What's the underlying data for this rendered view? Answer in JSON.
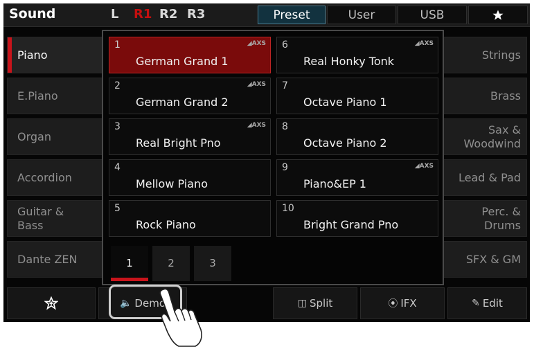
{
  "header": {
    "title": "Sound",
    "parts": [
      "L",
      "R1",
      "R2",
      "R3"
    ],
    "active_part": "R1",
    "tabs": [
      "Preset",
      "User",
      "USB"
    ],
    "active_tab": "Preset",
    "favorite_icon": "star-icon"
  },
  "categories_left": [
    "Piano",
    "E.Piano",
    "Organ",
    "Accordion",
    "Guitar &\nBass",
    "Dante ZEN"
  ],
  "categories_right": [
    "Strings",
    "Brass",
    "Sax &\nWoodwind",
    "Lead & Pad",
    "Perc. &\nDrums",
    "SFX & GM"
  ],
  "active_category": "Piano",
  "voices": [
    {
      "num": "1",
      "name": "German Grand 1",
      "badge": "AXS"
    },
    {
      "num": "6",
      "name": "Real Honky Tonk",
      "badge": "AXS"
    },
    {
      "num": "2",
      "name": "German Grand 2",
      "badge": "AXS"
    },
    {
      "num": "7",
      "name": "Octave Piano 1",
      "badge": ""
    },
    {
      "num": "3",
      "name": "Real Bright Pno",
      "badge": "AXS"
    },
    {
      "num": "8",
      "name": "Octave Piano 2",
      "badge": ""
    },
    {
      "num": "4",
      "name": "Mellow Piano",
      "badge": ""
    },
    {
      "num": "9",
      "name": "Piano&EP 1",
      "badge": "AXS"
    },
    {
      "num": "5",
      "name": "Rock Piano",
      "badge": ""
    },
    {
      "num": "10",
      "name": "Bright Grand Pno",
      "badge": ""
    }
  ],
  "selected_voice": "1",
  "pages": [
    "1",
    "2",
    "3"
  ],
  "active_page": "1",
  "bottom": {
    "favorite_icon": "star-plus-icon",
    "demo_label": "Demo",
    "split_label": "Split",
    "ifx_label": "IFX",
    "edit_label": "Edit"
  },
  "colors": {
    "accent_red": "#c8141b",
    "selected_voice_bg": "#7a0b0b",
    "active_tab_bg": "#12323f"
  }
}
